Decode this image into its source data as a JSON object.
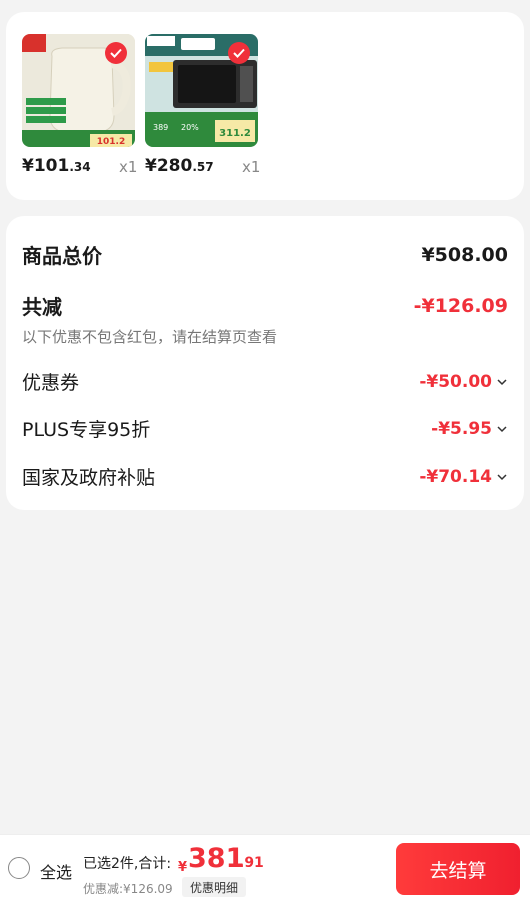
{
  "items": [
    {
      "price_int": "101",
      "price_dec": ".34",
      "qty": "x1",
      "image_lettering": [
        "2000W功率",
        "1.7升大容量",
        "304不锈钢内胆",
        "到手价",
        "101.2"
      ]
    },
    {
      "price_int": "280",
      "price_dec": ".57",
      "qty": "x1",
      "image_lettering": [
        "Midea",
        "NO.1",
        "到手价",
        "311.2",
        "20%"
      ]
    }
  ],
  "currency": "¥",
  "summary": {
    "total_label": "商品总价",
    "total_value": "¥508.00",
    "reduce_label": "共减",
    "reduce_value": "-¥126.09",
    "note": "以下优惠不包含红包，请在结算页查看",
    "discounts": [
      {
        "label": "优惠券",
        "amount": "-¥50.00"
      },
      {
        "label": "PLUS专享95折",
        "amount": "-¥5.95"
      },
      {
        "label": "国家及政府补贴",
        "amount": "-¥70.14"
      }
    ]
  },
  "bottom": {
    "select_all": "全选",
    "selected_info": "已选2件,合计:",
    "total_int": "381",
    "total_dec": ".91",
    "discount_info": "优惠减:¥126.09",
    "detail_label": "优惠明细",
    "checkout_label": "去结算"
  },
  "colors": {
    "accent": "#f0303a",
    "background": "#f3f3f3"
  }
}
